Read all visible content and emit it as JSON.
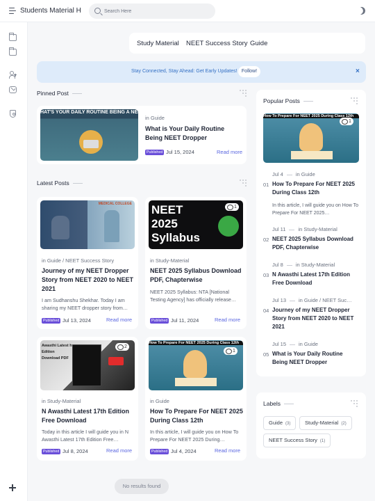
{
  "header": {
    "site_title": "Students Material Hub",
    "search_placeholder": "Search Here"
  },
  "nav": {
    "links": [
      "Study Material",
      "NEET Success Story",
      "Guide"
    ]
  },
  "notice": {
    "text": "Stay Connected, Stay Ahead: Get Early Updates!",
    "button": "Follow!",
    "close": "×"
  },
  "pinned": {
    "section_title": "Pinned Post",
    "thumb_text": "HAT'S YOUR DAILY ROUTINE BEING A NEET DROPPE",
    "category": "in Guide",
    "title": "What is Your Daily Routine Being NEET Dropper",
    "badge": "Published",
    "date": "Jul 15, 2024",
    "read_more": "Read more"
  },
  "latest": {
    "section_title": "Latest Posts",
    "posts": [
      {
        "category": "in Guide / NEET Success Story",
        "title": "Journey of my NEET Dropper Story from NEET 2020 to NEET 2021",
        "excerpt": "I am Sudhanshu Shekhar. Today I am sharing my NEET dropper story from…",
        "badge": "Published",
        "date": "Jul 13, 2024",
        "read_more": "Read more",
        "thumb_text": "MEDICAL COLLEGE"
      },
      {
        "category": "in Study-Material",
        "title": "NEET 2025 Syllabus Download PDF, Chapterwise",
        "excerpt": "NEET 2025 Syllabus: NTA [National Testing Agency] has officially release…",
        "badge": "Published",
        "date": "Jul 11, 2024",
        "read_more": "Read more",
        "comments": "1",
        "thumb_text": "NEET 2025 Syllabus"
      },
      {
        "category": "in Study-Material",
        "title": "N Awasthi Latest 17th Edition Free Download",
        "excerpt": "Today in this article I will guide you in N Awasthi Latest 17th Edition Free…",
        "badge": "Published",
        "date": "Jul 8, 2024",
        "read_more": "Read more",
        "comments": "2",
        "thumb_text": "Awasthi Latest h Edition Download PDF"
      },
      {
        "category": "in Guide",
        "title": "How To Prepare For NEET 2025 During Class 12th",
        "excerpt": "In this article, I will guide you on  How To Prepare For NEET 2025 During…",
        "badge": "Published",
        "date": "Jul 4, 2024",
        "read_more": "Read more",
        "comments": "1",
        "thumb_text": "How To Prepare For NEET 2025 During Class 12th"
      }
    ]
  },
  "popular": {
    "section_title": "Popular Posts",
    "thumb_text": "How To Prepare For NEET 2025 During Class 12th",
    "thumb_comments": "1",
    "items": [
      {
        "num": "01",
        "date": "Jul 4",
        "category": "in Guide",
        "title": "How To Prepare For NEET 2025 During Class 12th",
        "excerpt": "In this article, I will guide you on How To Prepare For NEET 2025…"
      },
      {
        "num": "02",
        "date": "Jul 11",
        "category": "in Study-Material",
        "title": "NEET 2025 Syllabus Download PDF, Chapterwise"
      },
      {
        "num": "03",
        "date": "Jul 8",
        "category": "in Study-Material",
        "title": "N Awasthi Latest 17th Edition Free Download"
      },
      {
        "num": "04",
        "date": "Jul 13",
        "category": "in Guide / NEET Suc…",
        "title": "Journey of my NEET Dropper Story from NEET 2020 to NEET 2021"
      },
      {
        "num": "05",
        "date": "Jul 15",
        "category": "in Guide",
        "title": "What is Your Daily Routine Being NEET Dropper"
      }
    ]
  },
  "labels": {
    "section_title": "Labels",
    "items": [
      {
        "name": "Guide",
        "count": "(3)"
      },
      {
        "name": "Study-Material",
        "count": "(2)"
      },
      {
        "name": "NEET Success Story",
        "count": "(1)"
      }
    ]
  },
  "toast": "No results found",
  "colors": {
    "accent": "#5a66e0",
    "badge": "#6a4fd9",
    "notice_bg": "#deebfa",
    "notice_text": "#3470c4"
  }
}
